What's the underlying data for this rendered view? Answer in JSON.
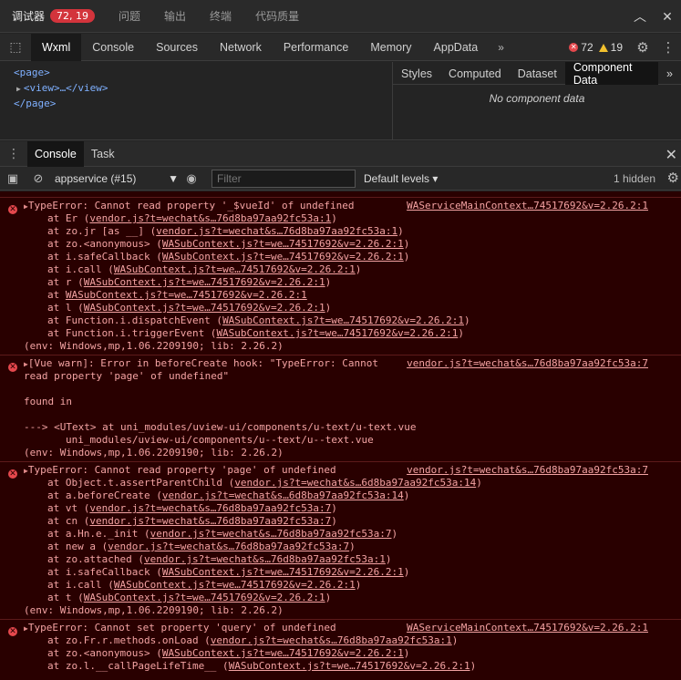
{
  "topbar": {
    "tabs": [
      "调试器",
      "问题",
      "输出",
      "终端",
      "代码质量"
    ],
    "badge": "72, 19"
  },
  "devtools": {
    "tabs": [
      "Wxml",
      "Console",
      "Sources",
      "Network",
      "Performance",
      "Memory",
      "AppData"
    ],
    "active_tab": "Wxml",
    "error_count": "72",
    "warning_count": "19"
  },
  "wxml_tree": {
    "lines": [
      "<page>",
      "<view>…</view>",
      "</page>"
    ]
  },
  "side_panel": {
    "tabs": [
      "Styles",
      "Computed",
      "Dataset",
      "Component Data"
    ],
    "active_tab": "Component Data",
    "empty_text": "No component data"
  },
  "drawer": {
    "tabs": [
      "Console",
      "Task"
    ]
  },
  "console_toolbar": {
    "context": "appservice (#15)",
    "filter_placeholder": "Filter",
    "levels": "Default levels",
    "hidden_count": "1 hidden"
  },
  "messages": [
    {
      "head": "TypeError: Cannot read property '_$vueId' of undefined",
      "source": "WAServiceMainContext…74517692&v=2.26.2:1",
      "lines": [
        [
          "at Er (",
          "vendor.js?t=wechat&s…76d8ba97aa92fc53a:1",
          ")"
        ],
        [
          "at zo.jr [as __] (",
          "vendor.js?t=wechat&s…76d8ba97aa92fc53a:1",
          ")"
        ],
        [
          "at zo.<anonymous> (",
          "WASubContext.js?t=we…74517692&v=2.26.2:1",
          ")"
        ],
        [
          "at i.safeCallback (",
          "WASubContext.js?t=we…74517692&v=2.26.2:1",
          ")"
        ],
        [
          "at i.call (",
          "WASubContext.js?t=we…74517692&v=2.26.2:1",
          ")"
        ],
        [
          "at r (",
          "WASubContext.js?t=we…74517692&v=2.26.2:1",
          ")"
        ],
        [
          "at ",
          "WASubContext.js?t=we…74517692&v=2.26.2:1",
          ""
        ],
        [
          "at l (",
          "WASubContext.js?t=we…74517692&v=2.26.2:1",
          ")"
        ],
        [
          "at Function.i.dispatchEvent (",
          "WASubContext.js?t=we…74517692&v=2.26.2:1",
          ")"
        ],
        [
          "at Function.i.triggerEvent (",
          "WASubContext.js?t=we…74517692&v=2.26.2:1",
          ")"
        ]
      ],
      "env": "(env: Windows,mp,1.06.2209190; lib: 2.26.2)"
    },
    {
      "head": "[Vue warn]: Error in beforeCreate hook: \"TypeError: Cannot",
      "head2": "read property 'page' of undefined\"",
      "source": "vendor.js?t=wechat&s…76d8ba97aa92fc53a:7",
      "found": "found in",
      "trace1": "---> <UText> at uni_modules/uview-ui/components/u-text/u-text.vue",
      "trace2": "uni_modules/uview-ui/components/u--text/u--text.vue",
      "env": "(env: Windows,mp,1.06.2209190; lib: 2.26.2)"
    },
    {
      "head": "TypeError: Cannot read property 'page' of undefined",
      "source": "vendor.js?t=wechat&s…76d8ba97aa92fc53a:7",
      "lines": [
        [
          "at Object.t.assertParentChild (",
          "vendor.js?t=wechat&s…6d8ba97aa92fc53a:14",
          ")"
        ],
        [
          "at a.beforeCreate (",
          "vendor.js?t=wechat&s…6d8ba97aa92fc53a:14",
          ")"
        ],
        [
          "at vt (",
          "vendor.js?t=wechat&s…76d8ba97aa92fc53a:7",
          ")"
        ],
        [
          "at cn (",
          "vendor.js?t=wechat&s…76d8ba97aa92fc53a:7",
          ")"
        ],
        [
          "at a.Hn.e._init (",
          "vendor.js?t=wechat&s…76d8ba97aa92fc53a:7",
          ")"
        ],
        [
          "at new a (",
          "vendor.js?t=wechat&s…76d8ba97aa92fc53a:7",
          ")"
        ],
        [
          "at zo.attached (",
          "vendor.js?t=wechat&s…76d8ba97aa92fc53a:1",
          ")"
        ],
        [
          "at i.safeCallback (",
          "WASubContext.js?t=we…74517692&v=2.26.2:1",
          ")"
        ],
        [
          "at i.call (",
          "WASubContext.js?t=we…74517692&v=2.26.2:1",
          ")"
        ],
        [
          "at t (",
          "WASubContext.js?t=we…74517692&v=2.26.2:1",
          ")"
        ]
      ],
      "env": "(env: Windows,mp,1.06.2209190; lib: 2.26.2)"
    },
    {
      "head": "TypeError: Cannot set property 'query' of undefined",
      "source": "WAServiceMainContext…74517692&v=2.26.2:1",
      "lines": [
        [
          "at zo.Fr.r.methods.onLoad (",
          "vendor.js?t=wechat&s…76d8ba97aa92fc53a:1",
          ")"
        ],
        [
          "at zo.<anonymous> (",
          "WASubContext.js?t=we…74517692&v=2.26.2:1",
          ")"
        ],
        [
          "at zo.l.__callPageLifeTime__ (",
          "WASubContext.js?t=we…74517692&v=2.26.2:1",
          ")"
        ]
      ]
    }
  ]
}
